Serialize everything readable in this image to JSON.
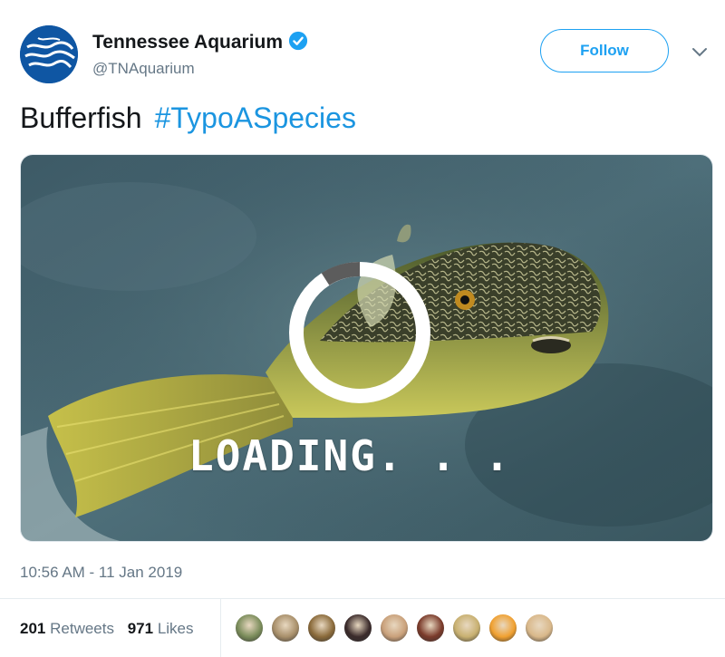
{
  "account": {
    "name": "Tennessee Aquarium",
    "handle": "@TNAquarium",
    "verified_icon": "verified-badge-icon",
    "avatar_icon": "river-logo-avatar"
  },
  "follow_button": {
    "label": "Follow"
  },
  "menu_icon": "chevron-down-icon",
  "tweet": {
    "text": "Bufferfish",
    "hashtag": "#TypoASpecies"
  },
  "media": {
    "overlay_text": "LOADING. . .",
    "spinner_icon": "loading-spinner-icon"
  },
  "timestamp": "10:56 AM - 11 Jan 2019",
  "stats": {
    "retweets_count": "201",
    "retweets_label": "Retweets",
    "likes_count": "971",
    "likes_label": "Likes"
  },
  "likers": [
    {
      "color": "#7a8c5a"
    },
    {
      "color": "#a88f6a"
    },
    {
      "color": "#8a6a3a"
    },
    {
      "color": "#3a2a2a"
    },
    {
      "color": "#c9a07a"
    },
    {
      "color": "#7a3a2a"
    },
    {
      "color": "#c8b070"
    },
    {
      "color": "#f0a030"
    },
    {
      "color": "#d9b88a"
    }
  ],
  "colors": {
    "accent": "#1da1f2",
    "hashtag": "#1b95e0",
    "muted": "#657786"
  }
}
